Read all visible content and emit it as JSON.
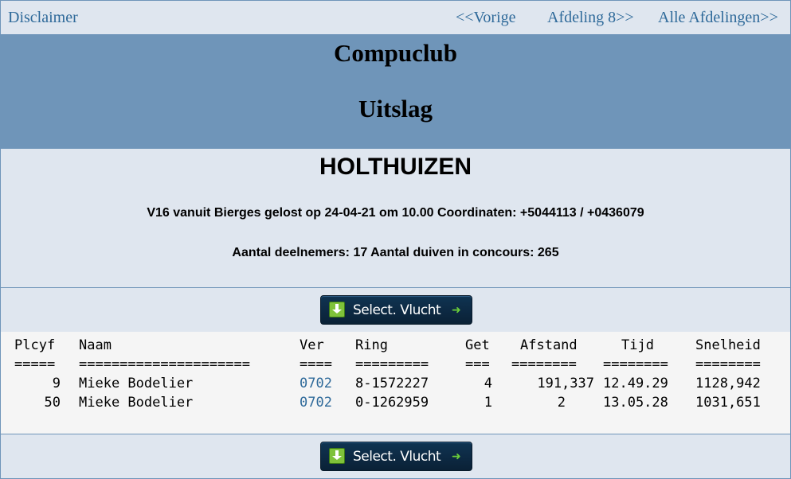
{
  "nav": {
    "disclaimer": "Disclaimer",
    "previous": "<<Vorige",
    "next": "Afdeling 8>>",
    "all": "Alle Afdelingen>>"
  },
  "banner": {
    "club": "Compuclub",
    "subtitle": "Uitslag"
  },
  "race": {
    "location": "HOLTHUIZEN",
    "details": "V16 vanuit Bierges gelost op 24-04-21 om 10.00 Coordinaten: +5044113 / +0436079",
    "participants": "Aantal deelnemers: 17 Aantal duiven in concours: 265"
  },
  "select_button": {
    "label": "Select. Vlucht",
    "icon": "download-icon",
    "arrow_icon": "arrow-right-icon"
  },
  "table": {
    "headers": [
      "Plcyf",
      "Naam",
      "Ver",
      "Ring",
      "Get",
      "Afstand",
      "Tijd",
      "Snelheid"
    ],
    "separators": [
      "=====",
      "=====================",
      "====",
      "=========",
      "===",
      "========",
      "========",
      "========"
    ],
    "rows": [
      [
        "9",
        "Mieke Bodelier",
        "0702",
        "8-1572227",
        "4",
        "191,337",
        "12.49.29",
        "1128,942"
      ],
      [
        "50",
        "Mieke Bodelier",
        "0702",
        "0-1262959",
        "1",
        "2",
        "13.05.28",
        "1031,651"
      ]
    ]
  },
  "colors": {
    "banner_bg": "#6f95b9",
    "page_bg": "#dfe6ef",
    "link": "#2f6a9a"
  }
}
